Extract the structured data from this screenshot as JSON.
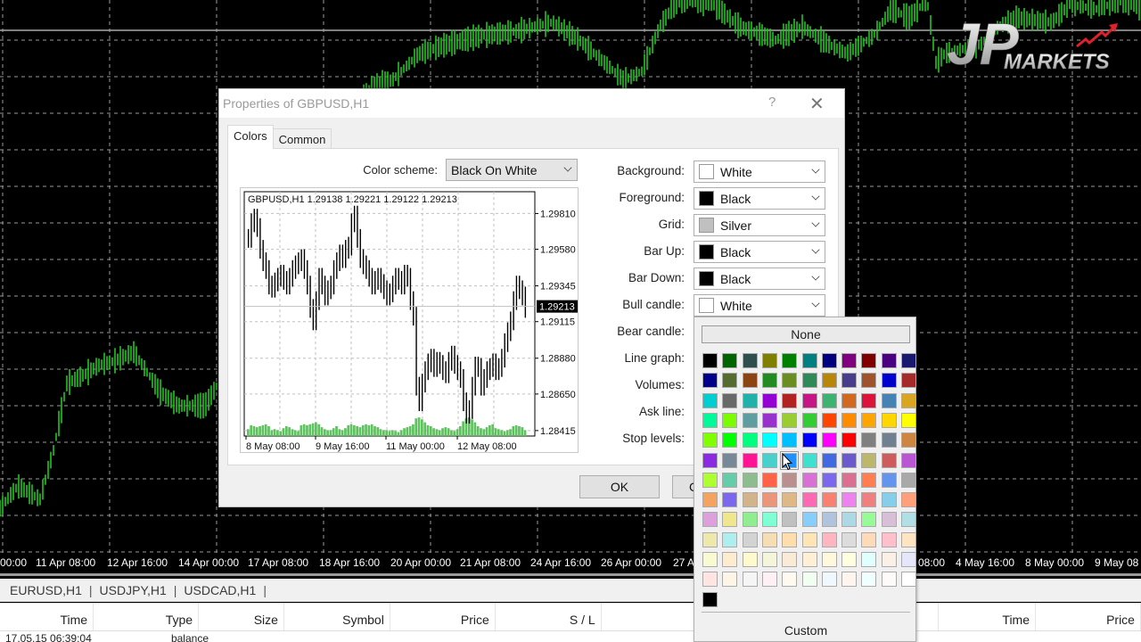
{
  "main_chart": {
    "time_axis": [
      "00:00",
      "11 Apr 08:00",
      "12 Apr 16:00",
      "14 Apr 00:00",
      "17 Apr 08:00",
      "18 Apr 16:00",
      "20 Apr 00:00",
      "21 Apr 08:00",
      "24 Apr 16:00",
      "26 Apr 00:00",
      "27 A",
      "08:00",
      "4 May 16:00",
      "8 May 00:00",
      "9 May 08"
    ],
    "bar_color": "#22c322",
    "grid_color": "#9a9a9a",
    "bg_color": "#000000"
  },
  "logo": {
    "initials": "JP",
    "word": "MARKETS"
  },
  "chart_tabs": [
    "EURUSD,H1",
    "USDJPY,H1",
    "USDCAD,H1"
  ],
  "terminal": {
    "columns": [
      "Time",
      "Type",
      "Size",
      "Symbol",
      "Price",
      "S / L",
      "",
      "Time",
      "Price"
    ],
    "row": [
      "17.05.15 06:39:04",
      "balance"
    ]
  },
  "dialog": {
    "title": "Properties of GBPUSD,H1",
    "help_icon": "?",
    "close_icon": "✕",
    "tabs": [
      {
        "label": "Colors",
        "active": true
      },
      {
        "label": "Common",
        "active": false
      }
    ],
    "color_scheme_label": "Color scheme:",
    "color_scheme_value": "Black On White",
    "properties": [
      {
        "label": "Background:",
        "value": "White",
        "color": "#ffffff"
      },
      {
        "label": "Foreground:",
        "value": "Black",
        "color": "#000000"
      },
      {
        "label": "Grid:",
        "value": "Silver",
        "color": "#c0c0c0"
      },
      {
        "label": "Bar Up:",
        "value": "Black",
        "color": "#000000"
      },
      {
        "label": "Bar Down:",
        "value": "Black",
        "color": "#000000"
      },
      {
        "label": "Bull candle:",
        "value": "White",
        "color": "#ffffff"
      },
      {
        "label": "Bear candle:",
        "value": "",
        "color": ""
      },
      {
        "label": "Line graph:",
        "value": "",
        "color": ""
      },
      {
        "label": "Volumes:",
        "value": "",
        "color": ""
      },
      {
        "label": "Ask line:",
        "value": "",
        "color": ""
      },
      {
        "label": "Stop levels:",
        "value": "",
        "color": ""
      }
    ],
    "ok_label": "OK",
    "cancel_label": "C"
  },
  "chart_data": {
    "type": "bar",
    "title": "GBPUSD,H1  1.29138 1.29221 1.29122 1.29213",
    "symbol": "GBPUSD,H1",
    "ohlc": {
      "open": 1.29138,
      "high": 1.29221,
      "low": 1.29122,
      "close": 1.29213
    },
    "current_price": "1.29213",
    "y_ticks": [
      "1.29810",
      "1.29580",
      "1.29345",
      "1.29115",
      "1.28880",
      "1.28650",
      "1.28415"
    ],
    "ylim": [
      1.2838,
      1.2995
    ],
    "x_ticks": [
      "8 May 08:00",
      "9 May 16:00",
      "11 May 00:00",
      "12 May 08:00"
    ],
    "closes": [
      1.2965,
      1.2975,
      1.2978,
      1.2972,
      1.2958,
      1.295,
      1.2945,
      1.2935,
      1.2933,
      1.2937,
      1.294,
      1.2942,
      1.2938,
      1.2935,
      1.294,
      1.2945,
      1.2948,
      1.295,
      1.2952,
      1.2945,
      1.2935,
      1.292,
      1.2912,
      1.2925,
      1.294,
      1.2935,
      1.2928,
      1.2932,
      1.2935,
      1.2945,
      1.295,
      1.2955,
      1.2952,
      1.2958,
      1.296,
      1.2975,
      1.298,
      1.2965,
      1.2952,
      1.2948,
      1.2945,
      1.294,
      1.2935,
      1.2938,
      1.294,
      1.2936,
      1.2932,
      1.2928,
      1.293,
      1.2935,
      1.294,
      1.2938,
      1.2935,
      1.2942,
      1.294,
      1.2925,
      1.2915,
      1.287,
      1.286,
      1.2872,
      1.288,
      1.2885,
      1.2888,
      1.2882,
      1.2886,
      1.2884,
      1.288,
      1.2878,
      1.2886,
      1.289,
      1.2884,
      1.288,
      1.2875,
      1.286,
      1.2852,
      1.2855,
      1.287,
      1.2883,
      1.2882,
      1.287,
      1.2875,
      1.288,
      1.2882,
      1.2885,
      1.288,
      1.2882,
      1.2888,
      1.2898,
      1.2905,
      1.2912,
      1.2925,
      1.2935,
      1.2932,
      1.2928,
      1.292
    ],
    "volumes": [
      0.35,
      0.55,
      0.5,
      0.45,
      0.5,
      0.55,
      0.6,
      0.5,
      0.3,
      0.35,
      0.3,
      0.25,
      0.4,
      0.5,
      0.45,
      0.35,
      0.3,
      0.25,
      0.55,
      0.6,
      0.55,
      0.6,
      0.65,
      0.7,
      0.6,
      0.45,
      0.35,
      0.3,
      0.3,
      0.4,
      0.5,
      0.35,
      0.3,
      0.4,
      0.55,
      0.6,
      0.55,
      0.5,
      0.45,
      0.55,
      0.6,
      0.55,
      0.6,
      0.5,
      0.45,
      0.35,
      0.3,
      0.3,
      0.25,
      0.3,
      0.25,
      0.2,
      0.3,
      0.4,
      0.45,
      0.5,
      0.6,
      0.9,
      0.95,
      0.85,
      0.7,
      0.55,
      0.5,
      0.4,
      0.35,
      0.3,
      0.4,
      0.45,
      0.4,
      0.3,
      0.25,
      0.35,
      0.5,
      0.75,
      0.9,
      0.95,
      0.85,
      0.7,
      0.5,
      0.4,
      0.35,
      0.45,
      0.55,
      0.6,
      0.4,
      0.35,
      0.3,
      0.25,
      0.3,
      0.35,
      0.5,
      0.55,
      0.5,
      0.45,
      0.3
    ],
    "bar_color": "#000000",
    "volume_color": "#5ec25e",
    "grid": true
  },
  "color_popup": {
    "none_label": "None",
    "custom_label": "Custom",
    "hovered_index": 59,
    "colors": [
      "#000000",
      "#006400",
      "#2f4f4f",
      "#808000",
      "#008000",
      "#008080",
      "#000080",
      "#800080",
      "#800000",
      "#4b0082",
      "#191970",
      "#00008b",
      "#556b2f",
      "#8b4513",
      "#228b22",
      "#6b8e23",
      "#2e8b57",
      "#b8860b",
      "#483d8b",
      "#a0522d",
      "#0000cd",
      "#a52a2a",
      "#00ced1",
      "#696969",
      "#20b2aa",
      "#9400d3",
      "#b22222",
      "#c71585",
      "#3cb371",
      "#d2691e",
      "#dc143c",
      "#4682b4",
      "#daa520",
      "#00fa9a",
      "#7cfc00",
      "#5f9ea0",
      "#9932cc",
      "#9acd32",
      "#32cd32",
      "#ff4500",
      "#ff8c00",
      "#ffa500",
      "#ffd700",
      "#ffff00",
      "#7fff00",
      "#00ff00",
      "#00ff7f",
      "#00ffff",
      "#00bfff",
      "#0000ff",
      "#ff00ff",
      "#ff0000",
      "#808080",
      "#708090",
      "#cd853f",
      "#8a2be2",
      "#778899",
      "#ff1493",
      "#48d1cc",
      "#1e90ff",
      "#40e0d0",
      "#4169e1",
      "#6a5acd",
      "#bdb76b",
      "#cd5c5c",
      "#ba55d3",
      "#adff2f",
      "#66cdaa",
      "#8fbc8f",
      "#ff6347",
      "#bc8f8f",
      "#da70d6",
      "#7b68ee",
      "#db7093",
      "#ff7f50",
      "#6495ed",
      "#a9a9a9",
      "#f4a460",
      "#7b68ee",
      "#d2b48c",
      "#e9967a",
      "#deb887",
      "#ff69b4",
      "#fa8072",
      "#ee82ee",
      "#f08080",
      "#87ceeb",
      "#ffa07a",
      "#dda0dd",
      "#f0e68c",
      "#90ee90",
      "#7fffd4",
      "#c0c0c0",
      "#87cefa",
      "#b0c4de",
      "#add8e6",
      "#98fb98",
      "#d8bfd8",
      "#b0e0e6",
      "#eee8aa",
      "#afeeee",
      "#d3d3d3",
      "#f5deb3",
      "#ffdead",
      "#ffe4b5",
      "#ffb6c1",
      "#dcdcdc",
      "#ffdab9",
      "#ffc0cb",
      "#ffe4c4",
      "#fafad2",
      "#ffebcd",
      "#fffacd",
      "#f5f5dc",
      "#faebd7",
      "#ffefd5",
      "#fff8dc",
      "#ffffe0",
      "#e0ffff",
      "#faf0e6",
      "#e6e6fa",
      "#ffe4e1",
      "#fdf5e6",
      "#f5f5f5",
      "#fff0f5",
      "#fffaf0",
      "#f0fff0",
      "#f0f8ff",
      "#fff5ee",
      "#f0ffff",
      "#fffafa",
      "#ffffff",
      "#000000"
    ]
  }
}
